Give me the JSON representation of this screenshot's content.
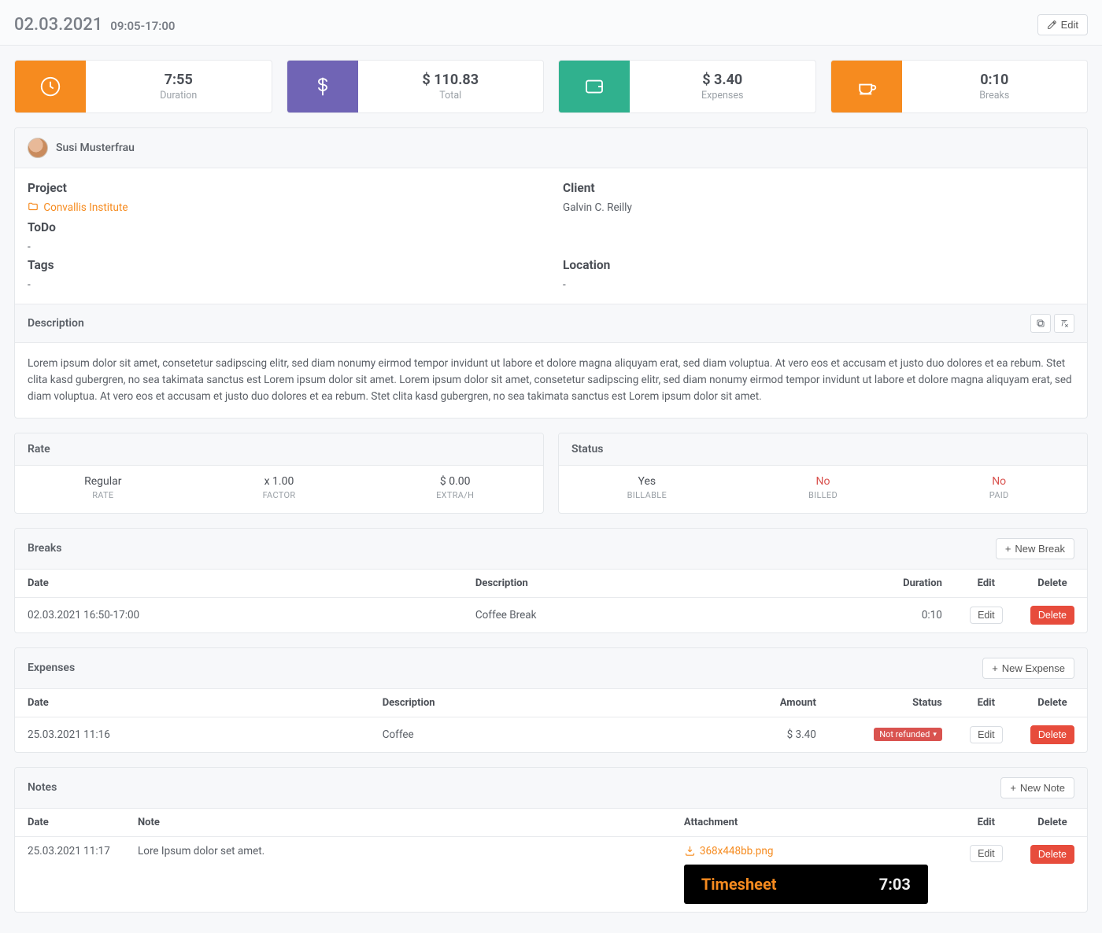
{
  "header": {
    "date": "02.03.2021",
    "time_range": "09:05-17:00",
    "edit_label": "Edit"
  },
  "stats": {
    "duration": {
      "value": "7:55",
      "label": "Duration"
    },
    "total": {
      "value": "$ 110.83",
      "label": "Total"
    },
    "expenses": {
      "value": "$ 3.40",
      "label": "Expenses"
    },
    "breaks": {
      "value": "0:10",
      "label": "Breaks"
    }
  },
  "user": {
    "name": "Susi Musterfrau"
  },
  "info": {
    "project_label": "Project",
    "project_value": "Convallis Institute",
    "client_label": "Client",
    "client_value": "Galvin C. Reilly",
    "todo_label": "ToDo",
    "todo_value": "-",
    "tags_label": "Tags",
    "tags_value": "-",
    "location_label": "Location",
    "location_value": "-"
  },
  "description": {
    "title": "Description",
    "body": "Lorem ipsum dolor sit amet, consetetur sadipscing elitr, sed diam nonumy eirmod tempor invidunt ut labore et dolore magna aliquyam erat, sed diam voluptua. At vero eos et accusam et justo duo dolores et ea rebum. Stet clita kasd gubergren, no sea takimata sanctus est Lorem ipsum dolor sit amet. Lorem ipsum dolor sit amet, consetetur sadipscing elitr, sed diam nonumy eirmod tempor invidunt ut labore et dolore magna aliquyam erat, sed diam voluptua. At vero eos et accusam et justo duo dolores et ea rebum. Stet clita kasd gubergren, no sea takimata sanctus est Lorem ipsum dolor sit amet."
  },
  "rate": {
    "title": "Rate",
    "rate_value": "Regular",
    "rate_label": "RATE",
    "factor_value": "x 1.00",
    "factor_label": "FACTOR",
    "extra_value": "$ 0.00",
    "extra_label": "EXTRA/H"
  },
  "status": {
    "title": "Status",
    "billable_value": "Yes",
    "billable_label": "BILLABLE",
    "billed_value": "No",
    "billed_label": "BILLED",
    "paid_value": "No",
    "paid_label": "PAID"
  },
  "breaks_section": {
    "title": "Breaks",
    "new_label": "New Break",
    "cols": {
      "date": "Date",
      "desc": "Description",
      "duration": "Duration",
      "edit": "Edit",
      "delete": "Delete"
    },
    "rows": [
      {
        "date": "02.03.2021 16:50-17:00",
        "desc": "Coffee Break",
        "duration": "0:10",
        "edit": "Edit",
        "delete": "Delete"
      }
    ]
  },
  "expenses_section": {
    "title": "Expenses",
    "new_label": "New Expense",
    "cols": {
      "date": "Date",
      "desc": "Description",
      "amount": "Amount",
      "status": "Status",
      "edit": "Edit",
      "delete": "Delete"
    },
    "rows": [
      {
        "date": "25.03.2021 11:16",
        "desc": "Coffee",
        "amount": "$ 3.40",
        "status": "Not refunded",
        "edit": "Edit",
        "delete": "Delete"
      }
    ]
  },
  "notes_section": {
    "title": "Notes",
    "new_label": "New Note",
    "cols": {
      "date": "Date",
      "note": "Note",
      "attachment": "Attachment",
      "edit": "Edit",
      "delete": "Delete"
    },
    "rows": [
      {
        "date": "25.03.2021 11:17",
        "note": "Lore Ipsum dolor set amet.",
        "attachment": "368x448bb.png",
        "edit": "Edit",
        "delete": "Delete",
        "preview": {
          "title": "Timesheet",
          "time": "7:03"
        }
      }
    ]
  }
}
